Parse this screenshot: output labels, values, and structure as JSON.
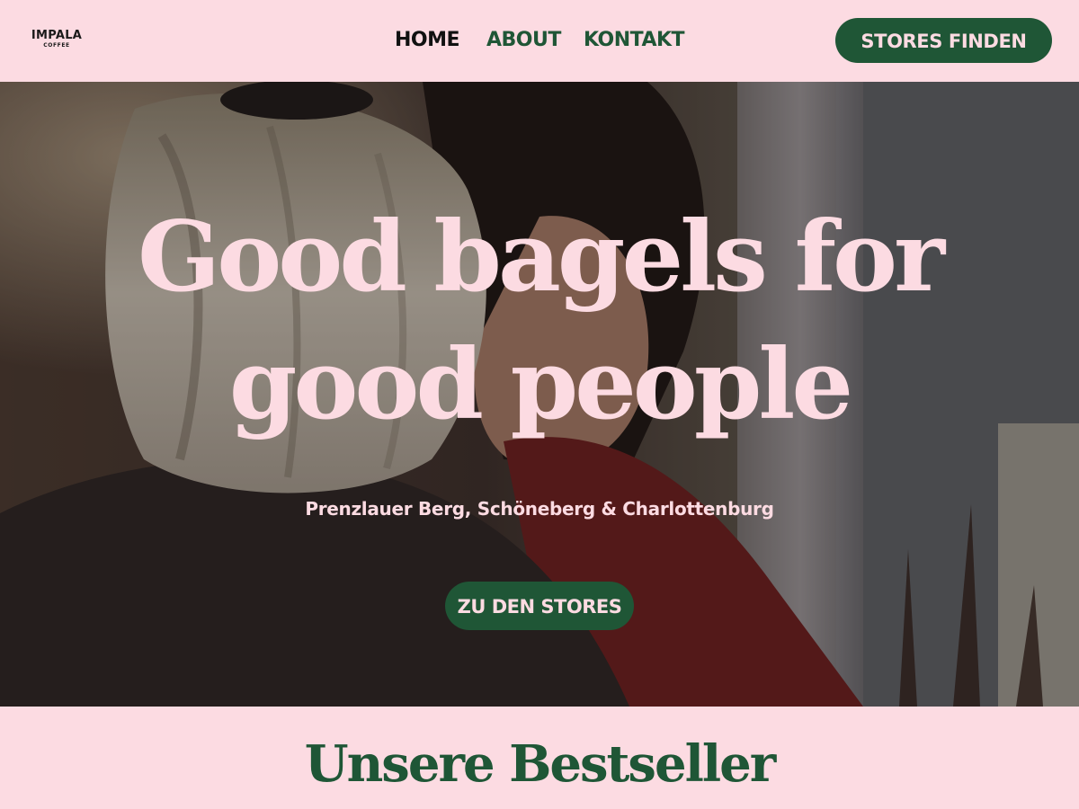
{
  "header": {
    "logo": {
      "main": "IMPALA",
      "sub": "COFFEE"
    },
    "nav": [
      {
        "label": "HOME",
        "active": true
      },
      {
        "label": "ABOUT",
        "active": false
      },
      {
        "label": "KONTAKT",
        "active": false
      }
    ],
    "cta_label": "STORES FINDEN"
  },
  "hero": {
    "title": "Good bagels for good people",
    "subtitle": "Prenzlauer Berg, Schöneberg & Charlottenburg",
    "cta_label": "ZU DEN STORES"
  },
  "bestseller": {
    "title": "Unsere Bestseller"
  },
  "colors": {
    "background_pink": "#fcdbe2",
    "brand_green": "#1f5636",
    "text_dark": "#111111"
  }
}
